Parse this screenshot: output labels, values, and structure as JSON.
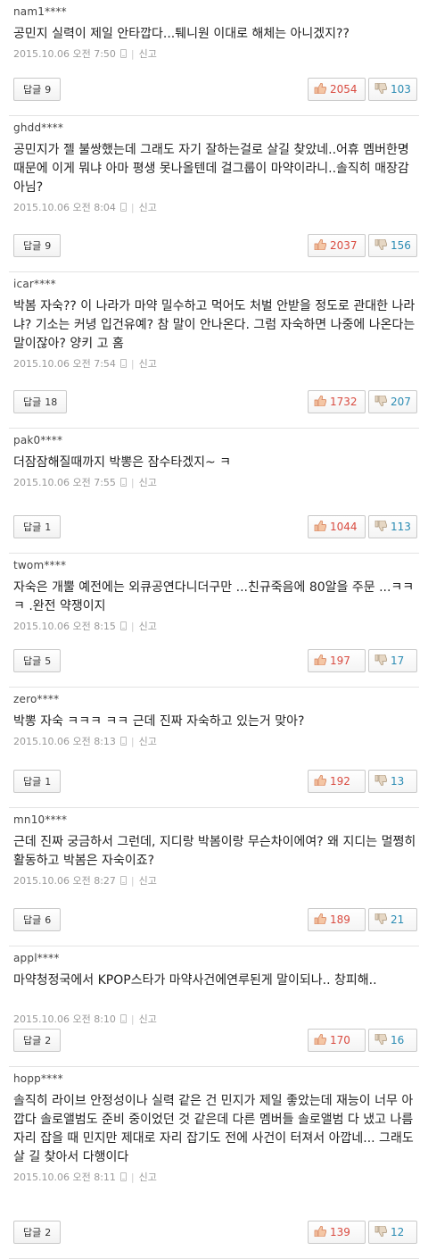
{
  "ui": {
    "reply_label": "답글",
    "report_label": "신고"
  },
  "comments": [
    {
      "user": "nam1****",
      "text": "공민지 실력이 제일 안타깝다...퉤니원 이대로 해체는 아니겠지??",
      "date": "2015.10.06 오전 7:50",
      "replies": "9",
      "likes": "2054",
      "dislikes": "103"
    },
    {
      "user": "ghdd****",
      "text": "공민지가 젤 불쌍했는데 그래도 자기 잘하는걸로 살길 찾았네..어휴 멤버한명때문에 이게 뭐냐 아마 평생 못나올텐데 걸그룹이 마약이라니..솔직히 매장감 아님?",
      "date": "2015.10.06 오전 8:04",
      "replies": "9",
      "likes": "2037",
      "dislikes": "156"
    },
    {
      "user": "icar****",
      "text": "박봄 자숙?? 이 나라가 마약 밀수하고 먹어도 처벌 안받을 정도로 관대한 나라냐? 기소는 커녕 입건유예? 참 말이 안나온다. 그럼 자숙하면 나중에 나온다는 말이잖아? 양키 고 홈",
      "date": "2015.10.06 오전 7:54",
      "replies": "18",
      "likes": "1732",
      "dislikes": "207"
    },
    {
      "user": "pak0****",
      "text": "더잠잠해질때까지 박뽕은 잠수타겠지~ ㅋ",
      "date": "2015.10.06 오전 7:55",
      "replies": "1",
      "likes": "1044",
      "dislikes": "113"
    },
    {
      "user": "twom****",
      "text": "자숙은 개뿔 예전에는 외큐공연다니더구만 ...친규죽음에 80알을 주문 ...ㅋㅋㅋ .완전 약쟁이지",
      "date": "2015.10.06 오전 8:15",
      "replies": "5",
      "likes": "197",
      "dislikes": "17"
    },
    {
      "user": "zero****",
      "text": "박뽕 자숙 ㅋㅋㅋ ㅋㅋ 근데 진짜 자숙하고 있는거 맞아?",
      "date": "2015.10.06 오전 8:13",
      "replies": "1",
      "likes": "192",
      "dislikes": "13"
    },
    {
      "user": "mn10****",
      "text": "근데 진짜 궁금하서 그런데, 지디랑 박봄이랑 무슨차이에여? 왜 지디는 멀쩡히 활동하고 박봄은 자숙이죠?",
      "date": "2015.10.06 오전 8:27",
      "replies": "6",
      "likes": "189",
      "dislikes": "21"
    },
    {
      "user": "appl****",
      "text": "마약청정국에서 KPOP스타가 마약사건에연루된게 말이되나.. 창피해..",
      "date": "2015.10.06 오전 8:10",
      "replies": "2",
      "likes": "170",
      "dislikes": "16"
    },
    {
      "user": "hopp****",
      "text": "솔직히 라이브 안정성이나 실력 같은 건 민지가 제일 좋았는데 재능이 너무 아깝다 솔로앨범도 준비 중이었던 것 같은데 다른 멤버들 솔로앨범 다 냈고 나름 자리 잡을 때 민지만 제대로 자리 잡기도 전에 사건이 터져서 아깝네... 그래도 살 길 찾아서 다행이다",
      "date": "2015.10.06 오전 8:11",
      "replies": "2",
      "likes": "139",
      "dislikes": "12"
    }
  ]
}
